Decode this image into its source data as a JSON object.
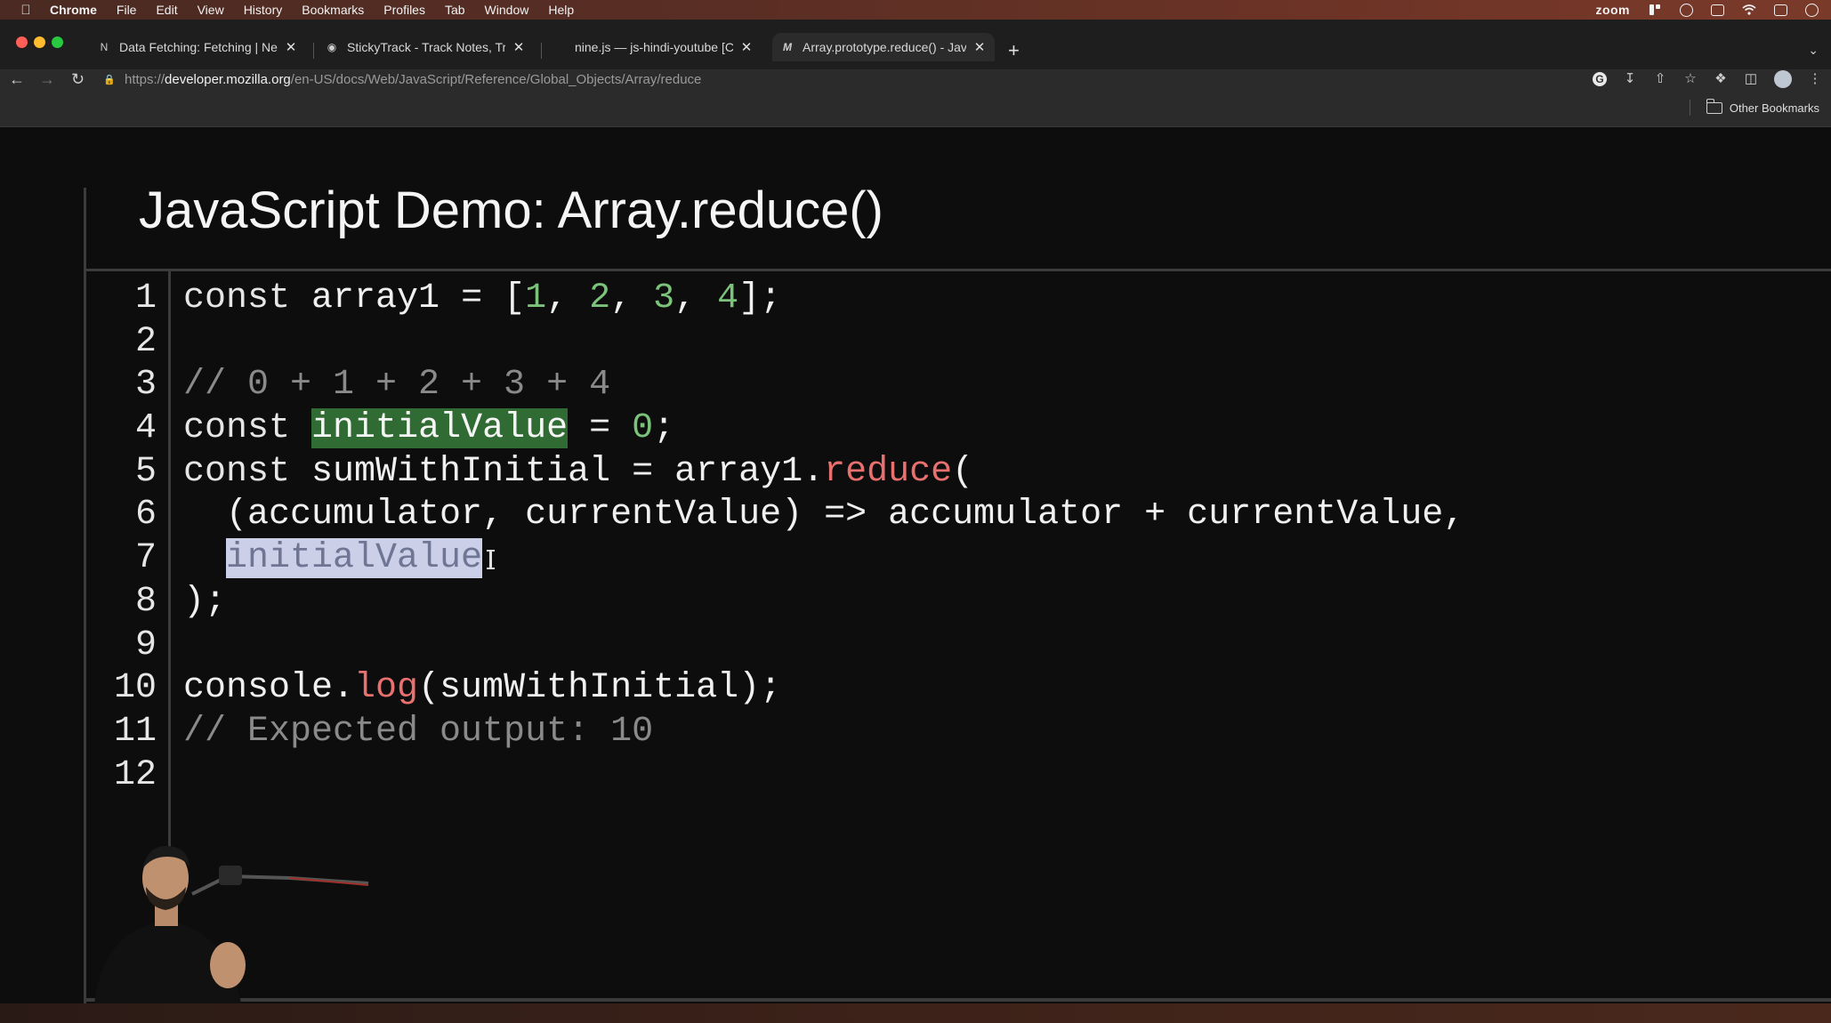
{
  "menubar": {
    "app": "Chrome",
    "items": [
      "File",
      "Edit",
      "View",
      "History",
      "Bookmarks",
      "Profiles",
      "Tab",
      "Window",
      "Help"
    ],
    "zoom_label": "zoom"
  },
  "tabs": [
    {
      "title": "Data Fetching: Fetching | Next",
      "favicon": "nextjs-icon",
      "active": false
    },
    {
      "title": "StickyTrack - Track Notes, Trac",
      "favicon": "globe-icon",
      "active": false
    },
    {
      "title": "nine.js — js-hindi-youtube [Co",
      "favicon": "vscode-icon",
      "active": false
    },
    {
      "title": "Array.prototype.reduce() - Jav",
      "favicon": "mdn-icon",
      "active": true
    }
  ],
  "url": {
    "scheme": "https://",
    "host": "developer.mozilla.org",
    "path": "/en-US/docs/Web/JavaScript/Reference/Global_Objects/Array/reduce"
  },
  "bookmarks": {
    "other_label": "Other Bookmarks"
  },
  "demo": {
    "title": "JavaScript Demo: Array.reduce()",
    "line_numbers": [
      "1",
      "2",
      "3",
      "4",
      "5",
      "6",
      "7",
      "8",
      "9",
      "10",
      "11",
      "12"
    ],
    "lines": {
      "l1": {
        "kw": "const",
        "a": " array1 = [",
        "n1": "1",
        "c1": ", ",
        "n2": "2",
        "c2": ", ",
        "n3": "3",
        "c3": ", ",
        "n4": "4",
        "end": "];"
      },
      "l3": {
        "comment": "// 0 + 1 + 2 + 3 + 4"
      },
      "l4": {
        "kw": "const",
        "sp": " ",
        "hl": "initialValue",
        "mid": " = ",
        "num": "0",
        "end": ";"
      },
      "l5": {
        "kw": "const",
        "a": " sumWithInitial = array1.",
        "fn": "reduce",
        "end": "("
      },
      "l6": {
        "text": "  (accumulator, currentValue) => accumulator + currentValue,"
      },
      "l7": {
        "indent": "  ",
        "sel": "initialValue"
      },
      "l8": {
        "text": ");"
      },
      "l10": {
        "a": "console.",
        "fn": "log",
        "end": "(sumWithInitial);"
      },
      "l11": {
        "comment": "// Expected output: 10"
      }
    }
  },
  "colors": {
    "number": "#7bc27a",
    "function": "#e8706e",
    "comment": "#8a8a8a",
    "highlight": "#2f6b33",
    "selection": "#cbd0e8"
  }
}
